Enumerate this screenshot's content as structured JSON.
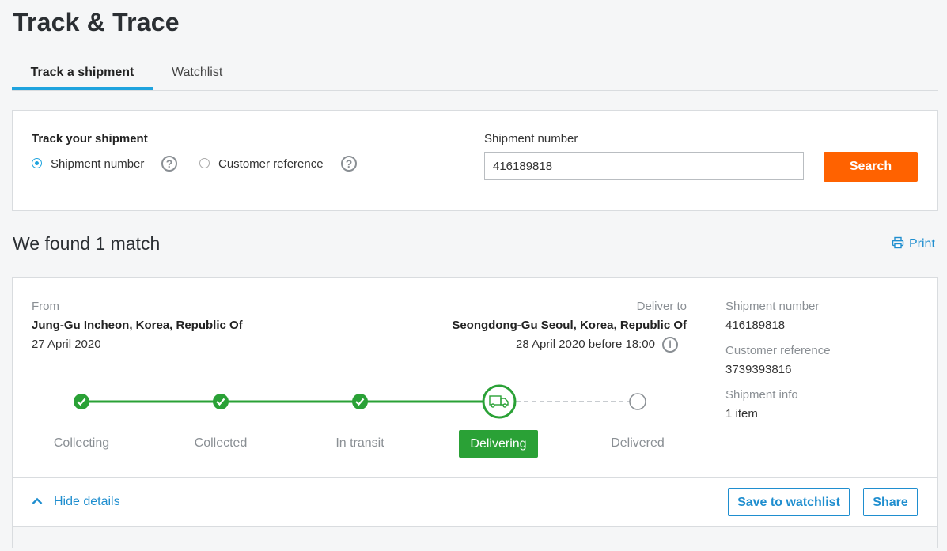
{
  "page": {
    "title": "Track & Trace"
  },
  "tabs": [
    {
      "label": "Track a shipment",
      "active": true
    },
    {
      "label": "Watchlist",
      "active": false
    }
  ],
  "search": {
    "heading": "Track your shipment",
    "options": [
      {
        "label": "Shipment number",
        "selected": true
      },
      {
        "label": "Customer reference",
        "selected": false
      }
    ],
    "help_glyph": "?",
    "field_label": "Shipment number",
    "field_value": "416189818",
    "button_label": "Search",
    "button_color": "#ff6200"
  },
  "results": {
    "heading": "We found 1 match",
    "print_label": "Print"
  },
  "shipment": {
    "from_label": "From",
    "from_location": "Jung-Gu Incheon, Korea, Republic Of",
    "from_date": "27 April 2020",
    "to_label": "Deliver to",
    "to_location": "Seongdong-Gu Seoul, Korea, Republic Of",
    "to_date": "28 April 2020 before 18:00",
    "info_glyph": "i",
    "details": [
      {
        "label": "Shipment number",
        "value": "416189818"
      },
      {
        "label": "Customer reference",
        "value": "3739393816"
      },
      {
        "label": "Shipment info",
        "value": "1 item"
      }
    ],
    "progress": {
      "current_index": 3,
      "accent_color": "#2aa136",
      "steps": [
        {
          "label": "Collecting",
          "state": "done"
        },
        {
          "label": "Collected",
          "state": "done"
        },
        {
          "label": "In transit",
          "state": "done"
        },
        {
          "label": "Delivering",
          "state": "current"
        },
        {
          "label": "Delivered",
          "state": "pending"
        }
      ]
    },
    "hide_details_label": "Hide details",
    "save_label": "Save to watchlist",
    "share_label": "Share"
  }
}
